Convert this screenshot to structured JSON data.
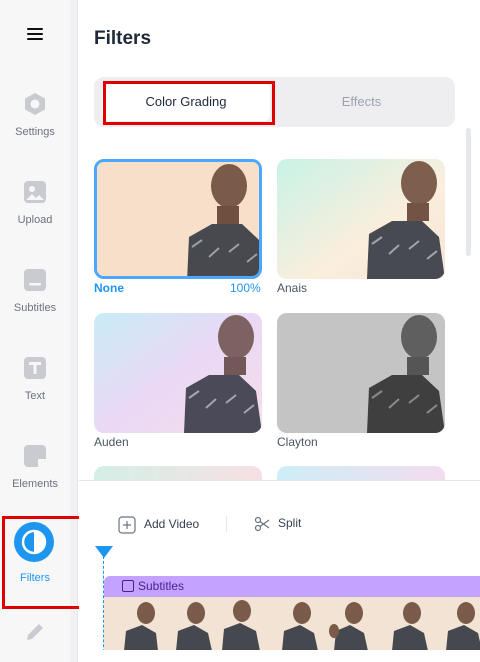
{
  "sidebar": {
    "items": [
      {
        "label": "Settings",
        "icon": "settings-icon"
      },
      {
        "label": "Upload",
        "icon": "image-upload-icon"
      },
      {
        "label": "Subtitles",
        "icon": "subtitles-icon"
      },
      {
        "label": "Text",
        "icon": "text-icon"
      },
      {
        "label": "Elements",
        "icon": "elements-icon"
      },
      {
        "label": "Filters",
        "icon": "filters-icon",
        "active": true
      },
      {
        "label": "",
        "icon": "pencil-icon"
      }
    ]
  },
  "panel": {
    "title": "Filters",
    "tabs": [
      {
        "label": "Color Grading",
        "active": true
      },
      {
        "label": "Effects",
        "active": false
      }
    ],
    "filters": [
      {
        "name": "None",
        "value": "100%",
        "selected": true
      },
      {
        "name": "Anais"
      },
      {
        "name": "Auden"
      },
      {
        "name": "Clayton"
      }
    ]
  },
  "timeline": {
    "add_video_label": "Add Video",
    "split_label": "Split",
    "subtitles_track_label": "Subtitles"
  },
  "colors": {
    "accent": "#1e96f0",
    "highlight": "#e00000",
    "subtitle_track": "#c4a2ff"
  }
}
